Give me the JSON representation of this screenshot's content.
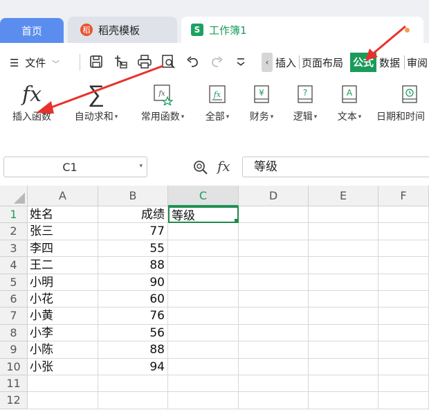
{
  "tabs": [
    {
      "label": "首页"
    },
    {
      "label": "稻壳模板",
      "logo": "稻"
    },
    {
      "label": "工作簿1",
      "logo": "S"
    }
  ],
  "menu": {
    "hamburger_label": "文件",
    "ribbon_tabs": [
      "插入",
      "页面布局",
      "公式",
      "数据",
      "审阅"
    ],
    "active_tab": "公式"
  },
  "toolbar": [
    {
      "id": "insert-function",
      "label": "插入函数",
      "icon": "fx-icon",
      "dropdown": false
    },
    {
      "id": "autosum",
      "label": "自动求和",
      "icon": "sigma-icon",
      "dropdown": true
    },
    {
      "id": "common-functions",
      "label": "常用函数",
      "icon": "star-fx-icon",
      "dropdown": true
    },
    {
      "id": "all-functions",
      "label": "全部",
      "icon": "fx-box-icon",
      "dropdown": true
    },
    {
      "id": "finance",
      "label": "财务",
      "icon": "book-yen-icon",
      "dropdown": true
    },
    {
      "id": "logic",
      "label": "逻辑",
      "icon": "book-question-icon",
      "dropdown": true
    },
    {
      "id": "text",
      "label": "文本",
      "icon": "book-a-icon",
      "dropdown": true
    },
    {
      "id": "datetime",
      "label": "日期和时间",
      "icon": "book-clock-icon",
      "dropdown": false
    }
  ],
  "formula_bar": {
    "name_box": "C1",
    "fx_symbol": "fx",
    "content": "等级"
  },
  "sheet": {
    "columns": [
      "A",
      "B",
      "C",
      "D",
      "E",
      "F"
    ],
    "selected_column": "C",
    "selected_row": "1",
    "rows": [
      {
        "n": "1",
        "a": "姓名",
        "b": "成绩",
        "c": "等级"
      },
      {
        "n": "2",
        "a": "张三",
        "b": "77",
        "c": ""
      },
      {
        "n": "3",
        "a": "李四",
        "b": "55",
        "c": ""
      },
      {
        "n": "4",
        "a": "王二",
        "b": "88",
        "c": ""
      },
      {
        "n": "5",
        "a": "小明",
        "b": "90",
        "c": ""
      },
      {
        "n": "6",
        "a": "小花",
        "b": "60",
        "c": ""
      },
      {
        "n": "7",
        "a": "小黄",
        "b": "76",
        "c": ""
      },
      {
        "n": "8",
        "a": "小李",
        "b": "56",
        "c": ""
      },
      {
        "n": "9",
        "a": "小陈",
        "b": "88",
        "c": ""
      },
      {
        "n": "10",
        "a": "小张",
        "b": "94",
        "c": ""
      },
      {
        "n": "11",
        "a": "",
        "b": "",
        "c": ""
      },
      {
        "n": "12",
        "a": "",
        "b": "",
        "c": ""
      }
    ]
  },
  "colors": {
    "accent_green": "#1a9b5a",
    "home_tab_blue": "#5b8def",
    "annotation_red": "#e8312a"
  }
}
